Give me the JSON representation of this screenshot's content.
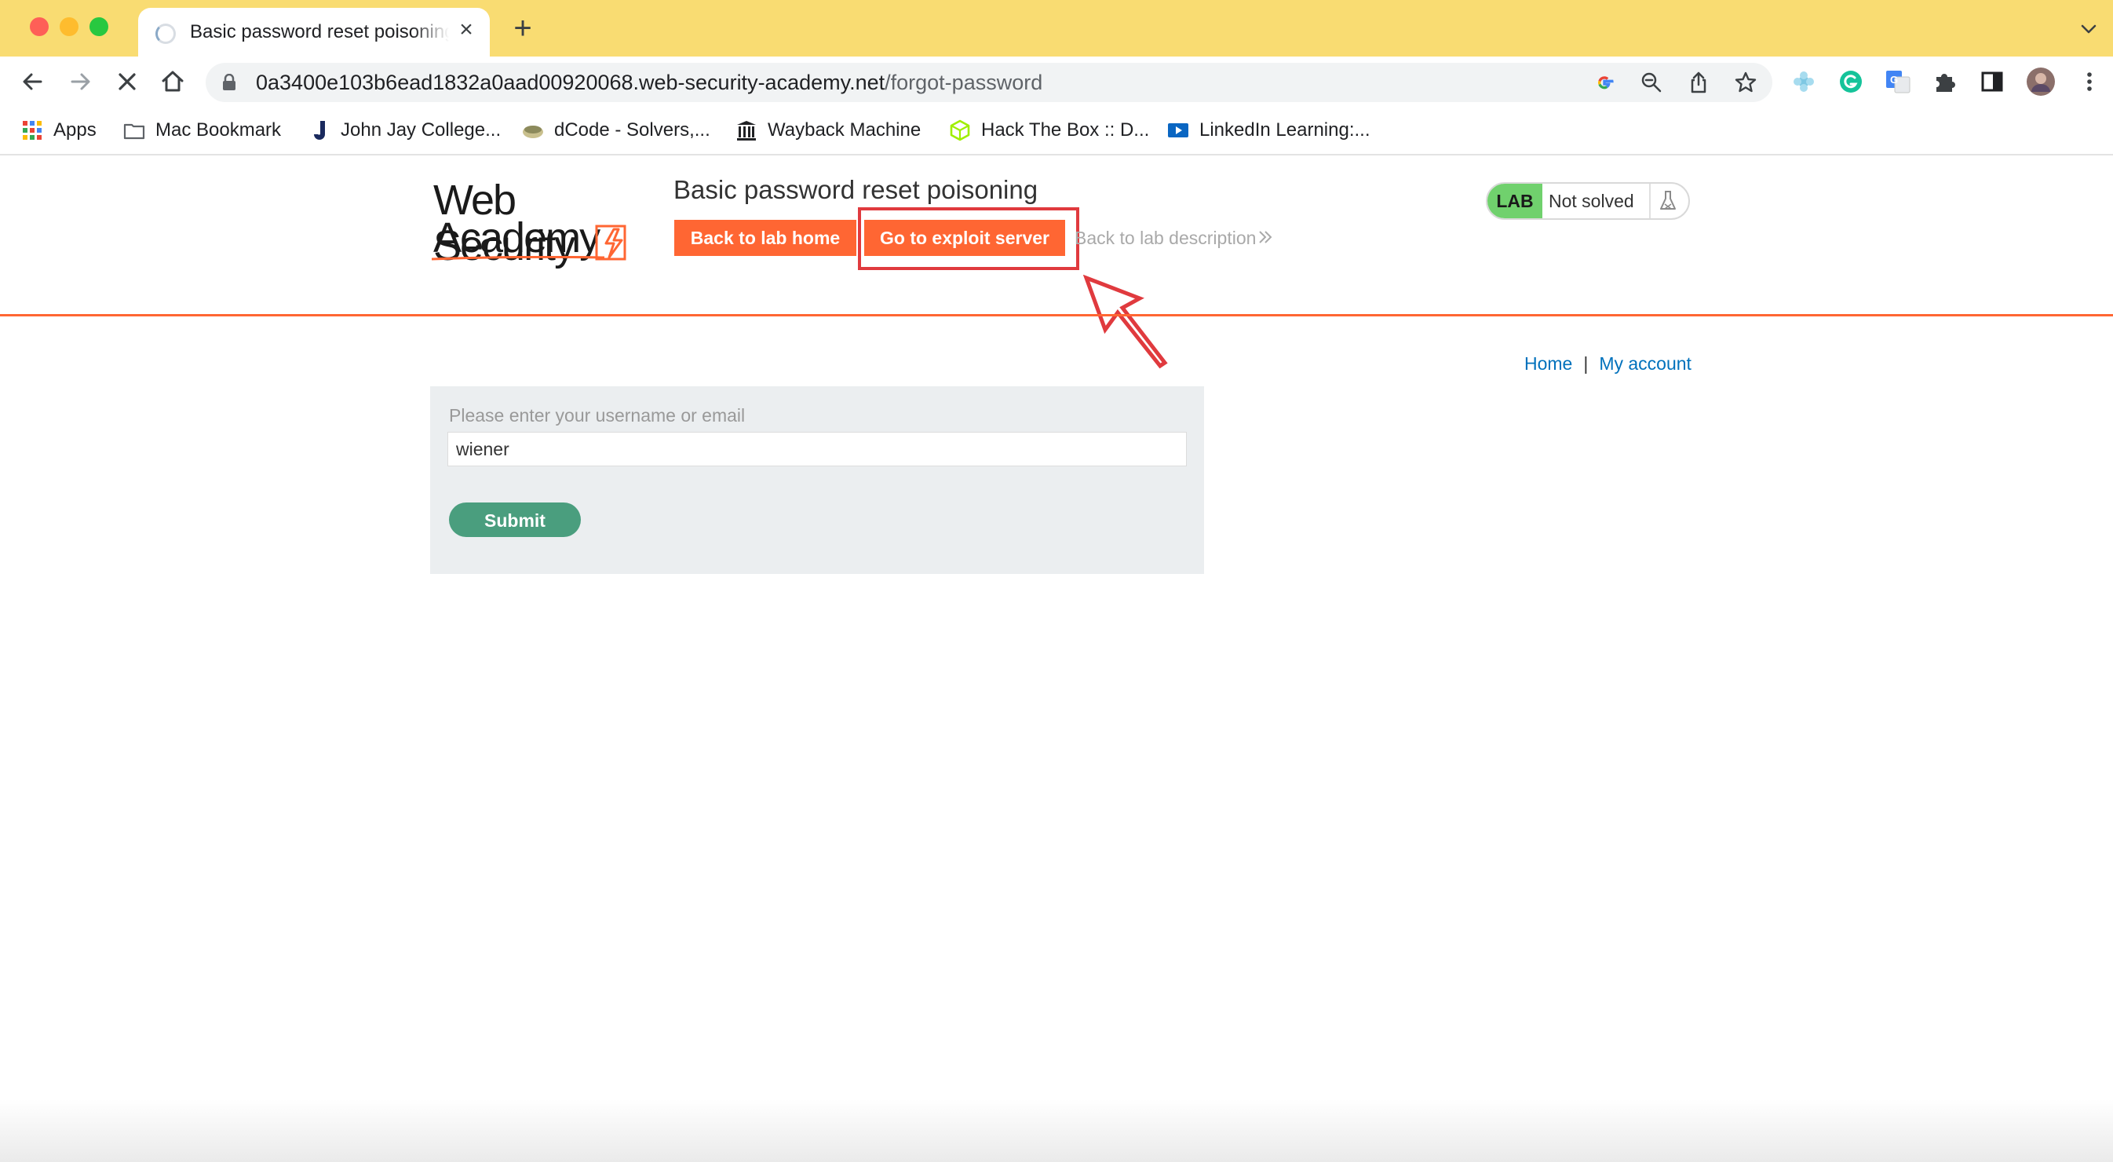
{
  "browser": {
    "tab": {
      "title": "Basic password reset poisoning",
      "spinner_icon": "loading-spinner-icon",
      "close_icon": "close-icon"
    },
    "new_tab_icon": "plus-icon",
    "url": {
      "host": "0a3400e103b6ead1832a0aad00920068.web-security-academy.net",
      "path": "/forgot-password"
    },
    "bookmarks": [
      {
        "label": "Apps",
        "icon": "apps-grid-icon"
      },
      {
        "label": "Mac Bookmark",
        "icon": "folder-icon"
      },
      {
        "label": "John Jay College...",
        "icon": "john-jay-icon"
      },
      {
        "label": "dCode - Solvers,...",
        "icon": "dcode-icon"
      },
      {
        "label": "Wayback Machine",
        "icon": "wayback-icon"
      },
      {
        "label": "Hack The Box :: D...",
        "icon": "hackthebox-icon"
      },
      {
        "label": "LinkedIn Learning:...",
        "icon": "linkedin-learning-icon"
      }
    ]
  },
  "page": {
    "logo": {
      "line1": "Web Security",
      "line2": "Academy"
    },
    "lab_title": "Basic password reset poisoning",
    "back_to_lab_home": "Back to lab home",
    "go_to_exploit_server": "Go to exploit server",
    "back_to_lab_description": "Back to lab description",
    "lab_badge": "LAB",
    "lab_status": "Not solved",
    "nav": {
      "home": "Home",
      "separator": "|",
      "my_account": "My account"
    },
    "form": {
      "label": "Please enter your username or email",
      "value": "wiener",
      "submit": "Submit"
    },
    "colors": {
      "accent_orange": "#ff6633",
      "annotation_red": "#e03a3e",
      "lab_green": "#70d16d",
      "submit_green": "#4a9e7e",
      "link_blue": "#0071bc"
    }
  }
}
